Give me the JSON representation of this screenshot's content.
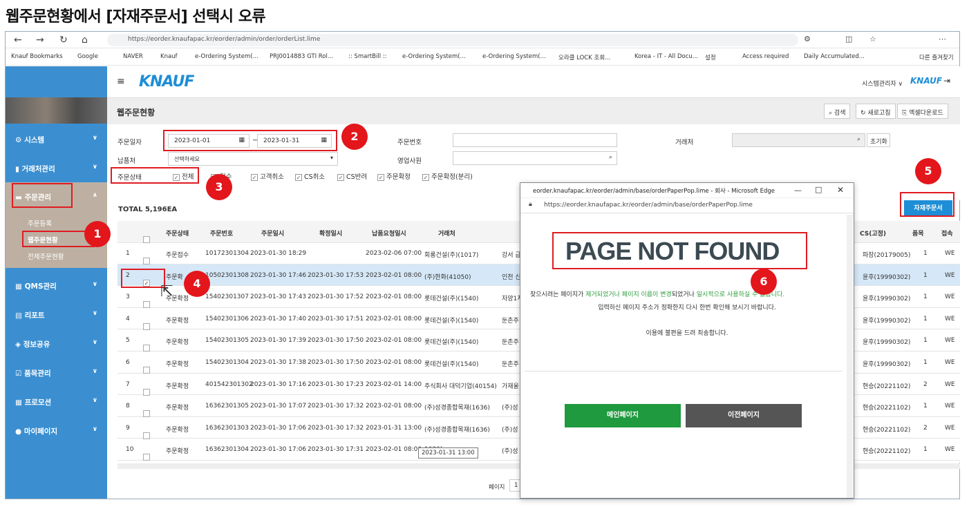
{
  "doc_title": "웹주문현황에서 [자재주문서] 선택시 오류",
  "browser": {
    "url": "https://eorder.knaufapac.kr/eorder/admin/order/orderList.lime",
    "bookmarks": [
      "Knauf Bookmarks",
      "Google",
      "NAVER",
      "Knauf",
      "e-Ordering System(...",
      "PRJ0014883 GTI Rol...",
      ":: SmartBill ::",
      "e-Ordering System(...",
      "e-Ordering System(...",
      "오라클 LOCK 조회...",
      "Korea - IT - All Docu...",
      "설정",
      "Access required",
      "Daily Accumulated...",
      "다른 즐겨찾기"
    ]
  },
  "sidebar": {
    "items": [
      "시스템",
      "거래처관리",
      "주문관리",
      "QMS관리",
      "리포트",
      "정보공유",
      "품목관리",
      "프로모션",
      "마이페이지"
    ],
    "sub": [
      "주문등록",
      "웹주문현황",
      "전체주문현황"
    ]
  },
  "topbar": {
    "logo": "KNAUF",
    "user": "시스템관리자 ∨",
    "user_logo": "KNAUF"
  },
  "page": {
    "title": "웹주문현황",
    "search_btn": "검색",
    "refresh_btn": "새로고침",
    "excel_btn": "엑셀다운로드"
  },
  "filter": {
    "order_date_label": "주문일자",
    "date_from": "2023-01-01",
    "date_sep": "~",
    "date_to": "2023-01-31",
    "order_no_label": "주문번호",
    "customer_label": "거래처",
    "reset_btn": "초기화",
    "delivery_label": "납품처",
    "delivery_placeholder": "선택하세요",
    "sales_label": "영업사원",
    "status_label": "주문상태",
    "statuses": [
      "전체",
      "접수",
      "고객취소",
      "CS취소",
      "CS반려",
      "주문확정",
      "주문확정(분리)"
    ]
  },
  "total": "TOTAL 5,196EA",
  "material_order_btn": "자재주문서",
  "table": {
    "headers": [
      "주문상태",
      "주문번호",
      "주문일시",
      "확정일시",
      "납품요청일시",
      "거래처",
      "CS(고정)",
      "품목",
      "접속"
    ],
    "rows": [
      {
        "no": "1",
        "checked": false,
        "status": "주문접수",
        "order_no": "10172301304",
        "order_dt": "2023-01-30 18:29",
        "confirm_dt": "",
        "req_dt": "2023-02-06 07:00",
        "customer": "회룡건설(주)(1017)",
        "extra": "강서 급",
        "cs": "파장(20179005)",
        "qty": "1",
        "conn": "WE"
      },
      {
        "no": "2",
        "checked": true,
        "status": "주문확",
        "order_no": "10502301308",
        "order_dt": "2023-01-30 17:46",
        "confirm_dt": "2023-01-30 17:53",
        "req_dt": "2023-02-01 08:00",
        "customer": "(주)한화(41050)",
        "extra": "인천 신",
        "cs": "윤후(19990302)",
        "qty": "1",
        "conn": "WE"
      },
      {
        "no": "3",
        "checked": false,
        "status": "주문확정",
        "order_no": "15402301307",
        "order_dt": "2023-01-30 17:43",
        "confirm_dt": "2023-01-30 17:52",
        "req_dt": "2023-02-01 08:00",
        "customer": "롯데건설(주)(1540)",
        "extra": "자양1지",
        "cs": "윤후(19990302)",
        "qty": "1",
        "conn": "WE"
      },
      {
        "no": "4",
        "checked": false,
        "status": "주문확정",
        "order_no": "15402301306",
        "order_dt": "2023-01-30 17:40",
        "confirm_dt": "2023-01-30 17:51",
        "req_dt": "2023-02-01 08:00",
        "customer": "롯데건설(주)(1540)",
        "extra": "둔촌주",
        "cs": "윤후(19990302)",
        "qty": "1",
        "conn": "WE"
      },
      {
        "no": "5",
        "checked": false,
        "status": "주문확정",
        "order_no": "15402301305",
        "order_dt": "2023-01-30 17:39",
        "confirm_dt": "2023-01-30 17:50",
        "req_dt": "2023-02-01 08:00",
        "customer": "롯데건설(주)(1540)",
        "extra": "둔촌주",
        "cs": "윤후(19990302)",
        "qty": "1",
        "conn": "WE"
      },
      {
        "no": "6",
        "checked": false,
        "status": "주문확정",
        "order_no": "15402301304",
        "order_dt": "2023-01-30 17:38",
        "confirm_dt": "2023-01-30 17:50",
        "req_dt": "2023-02-01 08:00",
        "customer": "롯데건설(주)(1540)",
        "extra": "둔촌주",
        "cs": "윤후(19990302)",
        "qty": "1",
        "conn": "WE"
      },
      {
        "no": "7",
        "checked": false,
        "status": "주문확정",
        "order_no": "401542301302",
        "order_dt": "2023-01-30 17:16",
        "confirm_dt": "2023-01-30 17:23",
        "req_dt": "2023-02-01 14:00",
        "customer": "주식회사 대덕기업(40154)",
        "extra": "가재울",
        "cs": "현승(20221102)",
        "qty": "2",
        "conn": "WE"
      },
      {
        "no": "8",
        "checked": false,
        "status": "주문확정",
        "order_no": "16362301305",
        "order_dt": "2023-01-30 17:07",
        "confirm_dt": "2023-01-30 17:32",
        "req_dt": "2023-02-01 08:00",
        "customer": "(주)성경종합목재(1636)",
        "extra": "(주)성",
        "cs": "현승(20221102)",
        "qty": "1",
        "conn": "WE"
      },
      {
        "no": "9",
        "checked": false,
        "status": "주문확정",
        "order_no": "16362301303",
        "order_dt": "2023-01-30 17:06",
        "confirm_dt": "2023-01-30 17:32",
        "req_dt": "2023-01-31 13:00",
        "customer": "(주)성경종합목재(1636)",
        "extra": "(주)성",
        "cs": "현승(20221102)",
        "qty": "2",
        "conn": "WE"
      },
      {
        "no": "10",
        "checked": false,
        "status": "주문확정",
        "order_no": "16362301304",
        "order_dt": "2023-01-30 17:06",
        "confirm_dt": "2023-01-30 17:31",
        "req_dt": "2023-02-01 08:00",
        "customer": "1636)",
        "extra": "(주)성",
        "cs": "현승(20221102)",
        "qty": "1",
        "conn": "WE"
      }
    ],
    "tooltip": "2023-01-31 13:00",
    "pager_label": "페이지",
    "pager_value": "1"
  },
  "popup": {
    "title": "eorder.knaufapac.kr/eorder/admin/base/orderPaperPop.lime - 회사 - Microsoft Edge",
    "url": "https://eorder.knaufapac.kr/eorder/admin/base/orderPaperPop.lime",
    "heading": "PAGE NOT FOUND",
    "msg_a": "찾으시려는 페이지가 ",
    "msg_b": "제거되었거나 페이지 이름이 변경",
    "msg_c": "되었거나 ",
    "msg_d": "일시적으로 사용하실 수 없습니다.",
    "msg2": "입력하신 페이지 주소가 정확한지 다시 한번 확인해 보시기 바랍니다.",
    "msg3": "이용에 불편을 드려 죄송합니다.",
    "main_btn": "메인페이지",
    "prev_btn": "이전페이지"
  },
  "callouts": [
    "1",
    "2",
    "3",
    "4",
    "5",
    "6"
  ]
}
